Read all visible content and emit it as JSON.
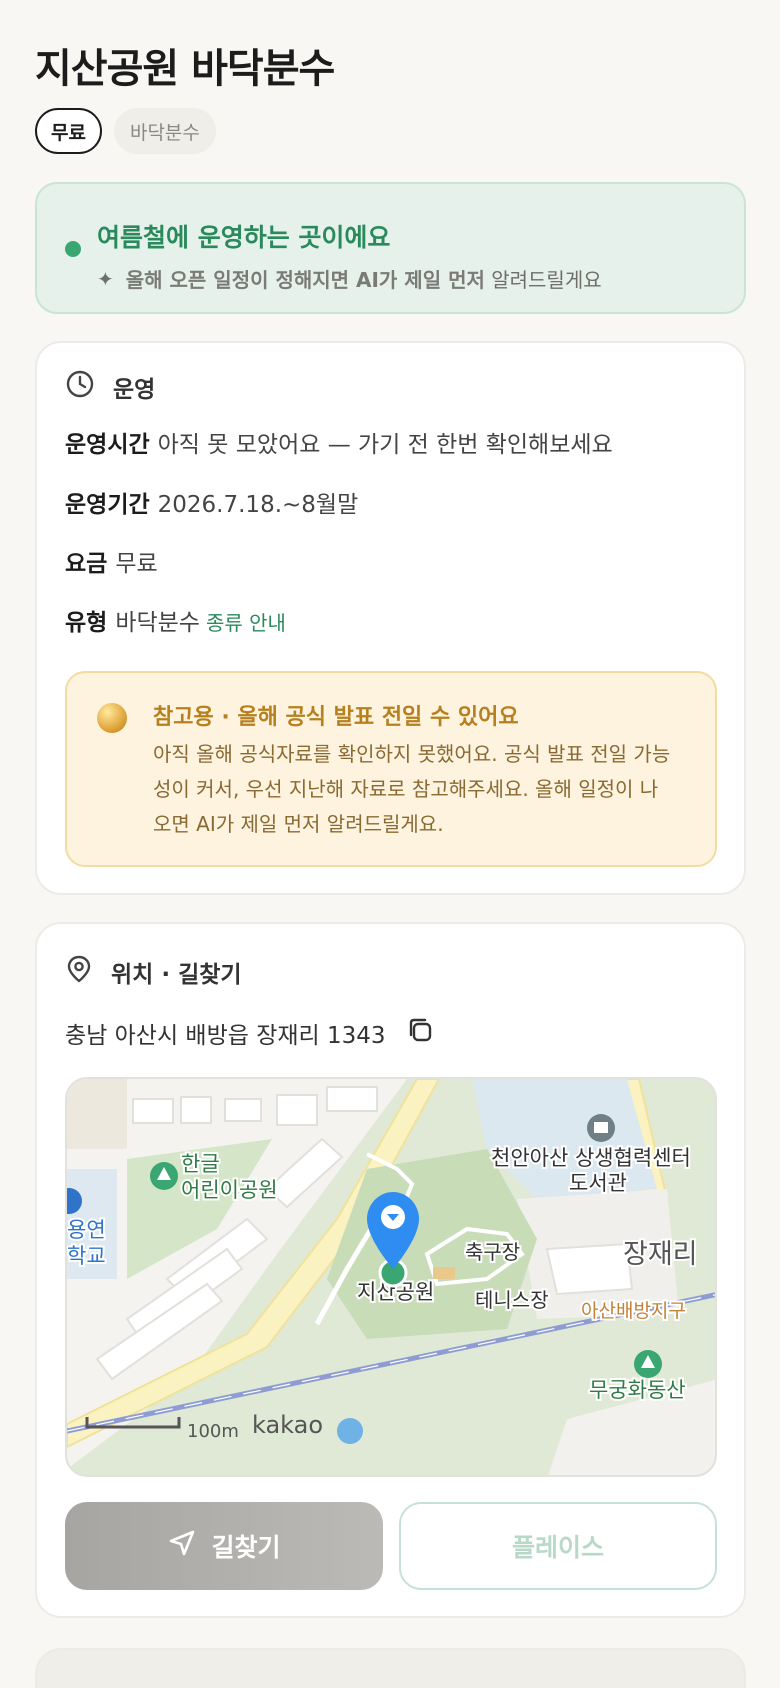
{
  "title": "지산공원 바닥분수",
  "tags": [
    "무료",
    "바닥분수"
  ],
  "season": {
    "headline": "여름철에 운영하는 곳이에요",
    "sub_bold": "올해 오픈 일정이 정해지면 AI가 제일 먼저",
    "sub_rest": "알려드릴게요"
  },
  "operation": {
    "header": "운영",
    "rows": [
      {
        "label": "운영시간",
        "value": "아직 못 모았어요 — 가기 전 한번 확인해보세요"
      },
      {
        "label": "운영기간",
        "value": "2026.7.18.~8월말"
      },
      {
        "label": "요금",
        "value": "무료"
      },
      {
        "label": "유형",
        "value": "바닥분수",
        "link": "종류 안내"
      }
    ],
    "notice": {
      "title": "참고용 · 올해 공식 발표 전일 수 있어요",
      "body": "아직 올해 공식자료를 확인하지 못했어요. 공식 발표 전일 가능성이 커서, 우선 지난해 자료로 참고해주세요. 올해 일정이 나오면 AI가 제일 먼저 알려드릴게요."
    }
  },
  "location": {
    "header": "위치 · 길찾기",
    "address": "충남 아산시 배방읍 장재리 1343",
    "map_labels": {
      "park1": "한글",
      "park1b": "어린이공원",
      "school1": "용연",
      "school2": "학교",
      "center1": "천안아산 상생협력센터",
      "center2": "도서관",
      "field": "축구장",
      "tennis": "테니스장",
      "poi": "지산공원",
      "district": "장재리",
      "district2": "아산배방지구",
      "hill": "무궁화동산",
      "scale": "100m",
      "brand": "kakao"
    },
    "buttons": {
      "directions": "길찾기",
      "places": "플레이스"
    }
  },
  "colors": {
    "accent_green": "#2a8a5c",
    "notice_gold": "#b7801e",
    "pin_blue": "#2f8cf0"
  }
}
